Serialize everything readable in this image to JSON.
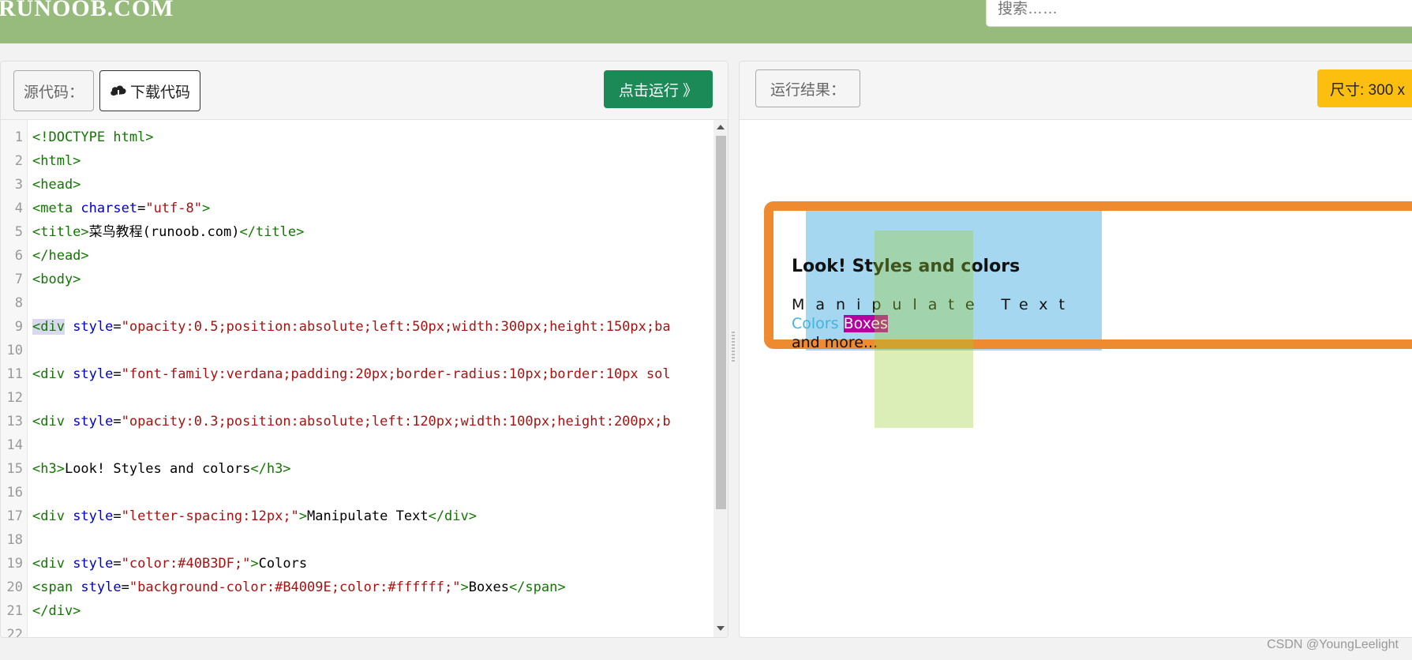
{
  "header": {
    "logo": "RUNOOB.COM",
    "search_placeholder": "搜索……"
  },
  "editor": {
    "source_label": "源代码：",
    "download_label": "下载代码",
    "run_label": "点击运行 》",
    "line_numbers": [
      "1",
      "2",
      "3",
      "4",
      "5",
      "6",
      "7",
      "8",
      "9",
      "10",
      "11",
      "12",
      "13",
      "14",
      "15",
      "16",
      "17",
      "18",
      "19",
      "20",
      "21",
      "22"
    ],
    "code": {
      "l1": "<!DOCTYPE html>",
      "l2": "<html>",
      "l3": "<head>",
      "l4_tag": "<meta",
      "l4_attr": " charset",
      "l4_eq": "=",
      "l4_val": "\"utf-8\"",
      "l4_end": ">",
      "l5_open": "<title>",
      "l5_text": "菜鸟教程(runoob.com)",
      "l5_close": "</title>",
      "l6": "</head>",
      "l7": "<body>",
      "l9_tag": "<div",
      "l9_attr": " style",
      "l9_eq": "=",
      "l9_val": "\"opacity:0.5;position:absolute;left:50px;width:300px;height:150px;ba",
      "l11_tag": "<div",
      "l11_attr": " style",
      "l11_eq": "=",
      "l11_val": "\"font-family:verdana;padding:20px;border-radius:10px;border:10px sol",
      "l13_tag": "<div",
      "l13_attr": " style",
      "l13_eq": "=",
      "l13_val": "\"opacity:0.3;position:absolute;left:120px;width:100px;height:200px;b",
      "l15_open": "<h3>",
      "l15_text": "Look! Styles and colors",
      "l15_close": "</h3>",
      "l17_tag": "<div",
      "l17_attr": " style",
      "l17_eq": "=",
      "l17_val": "\"letter-spacing:12px;\"",
      "l17_end": ">",
      "l17_text": "Manipulate Text",
      "l17_close": "</div>",
      "l19_tag": "<div",
      "l19_attr": " style",
      "l19_eq": "=",
      "l19_val": "\"color:#40B3DF;\"",
      "l19_end": ">",
      "l19_text": "Colors",
      "l20_tag": "<span",
      "l20_attr": " style",
      "l20_eq": "=",
      "l20_val": "\"background-color:#B4009E;color:#ffffff;\"",
      "l20_end": ">",
      "l20_text": "Boxes",
      "l20_close": "</span>",
      "l21": "</div>"
    }
  },
  "result": {
    "label": "运行结果：",
    "size_label": "尺寸: 300 x",
    "heading": "Look! Styles and colors",
    "manipulate": "Manipulate Text",
    "colors": "Colors",
    "boxes": "Boxes",
    "more": "and more..."
  },
  "watermark": "CSDN @YoungLeelight",
  "colors": {
    "header_bg": "#96bb7c",
    "run_button": "#1c8a57",
    "size_badge": "#fdbf0f",
    "orange_border": "#ee8a30",
    "text_blue": "#40B3DF",
    "box_magenta": "#B4009E"
  }
}
